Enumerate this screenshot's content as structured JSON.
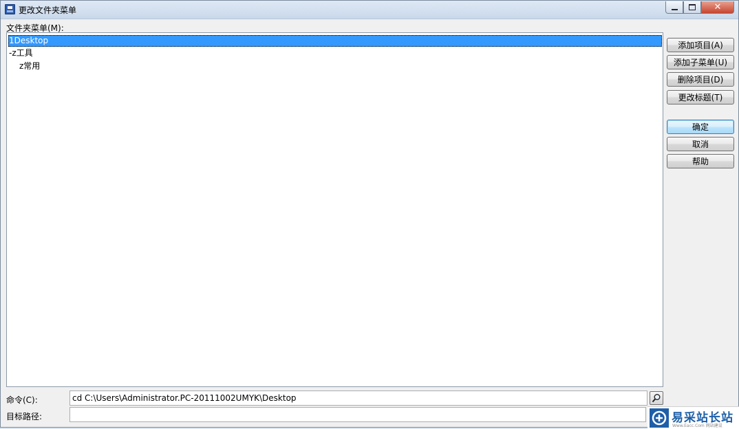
{
  "window": {
    "title": "更改文件夹菜单"
  },
  "titlebar_buttons": {
    "minimize": "minimize",
    "maximize": "maximize",
    "close": "✕"
  },
  "menu": {
    "label": "文件夹菜单(M):",
    "items": [
      {
        "label": "1Desktop",
        "selected": true
      },
      {
        "label": "-z工具"
      },
      {
        "label": "z常用"
      }
    ]
  },
  "buttons": {
    "add_item": "添加项目(A)",
    "add_submenu": "添加子菜单(U)",
    "delete_item": "删除项目(D)",
    "change_title": "更改标题(T)",
    "ok": "确定",
    "cancel": "取消",
    "help": "帮助"
  },
  "fields": {
    "command_label": "命令(C):",
    "command_value": "cd C:\\Users\\Administrator.PC-20111002UMYK\\Desktop",
    "target_label": "目标路径:",
    "target_value": ""
  },
  "watermark": {
    "text": "易采站长站",
    "sub": "Www.Eacc.Com 网站建设"
  },
  "colors": {
    "selection": "#3399ff",
    "brand": "#1e5fa8"
  }
}
